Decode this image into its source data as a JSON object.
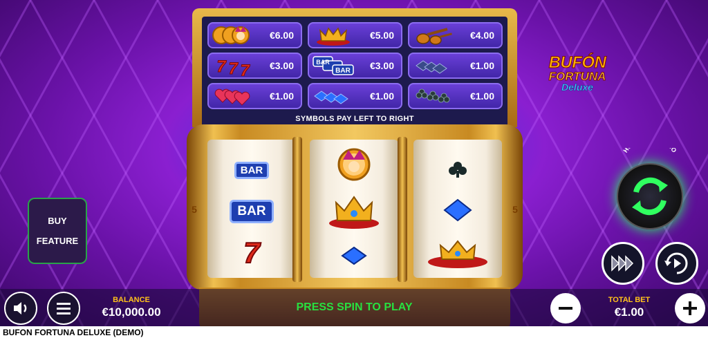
{
  "paytable": {
    "rows": [
      [
        {
          "symbol": "jester-coins-icon",
          "value": "€6.00"
        },
        {
          "symbol": "crown-icon",
          "value": "€5.00"
        },
        {
          "symbol": "lute-icon",
          "value": "€4.00"
        }
      ],
      [
        {
          "symbol": "seven-icon",
          "value": "€3.00"
        },
        {
          "symbol": "bar-icon",
          "value": "€3.00"
        },
        {
          "symbol": "spade-icon",
          "value": "€1.00"
        }
      ],
      [
        {
          "symbol": "heart-icon",
          "value": "€1.00"
        },
        {
          "symbol": "diamond-icon",
          "value": "€1.00"
        },
        {
          "symbol": "club-icon",
          "value": "€1.00"
        }
      ]
    ],
    "note": "SYMBOLS PAY LEFT TO RIGHT"
  },
  "reels": {
    "bar_text": "BAR",
    "side_number": "5"
  },
  "logo": {
    "line1": "BUFÓN",
    "line2": "FORTUNA",
    "line3": "Deluxe"
  },
  "spin": {
    "hold_text": "HOLD FOR TURBO"
  },
  "buy_feature": {
    "line1": "BUY",
    "line2": "FEATURE"
  },
  "balance": {
    "label": "BALANCE",
    "value": "€10,000.00"
  },
  "status": {
    "message": "PRESS SPIN TO PLAY"
  },
  "total_bet": {
    "label": "TOTAL BET",
    "value": "€1.00"
  },
  "footer": {
    "title": "BUFON FORTUNA DELUXE (DEMO)"
  },
  "colors": {
    "accent_green": "#28e040",
    "gold": "#ffc21a",
    "panel": "#4226a8"
  }
}
